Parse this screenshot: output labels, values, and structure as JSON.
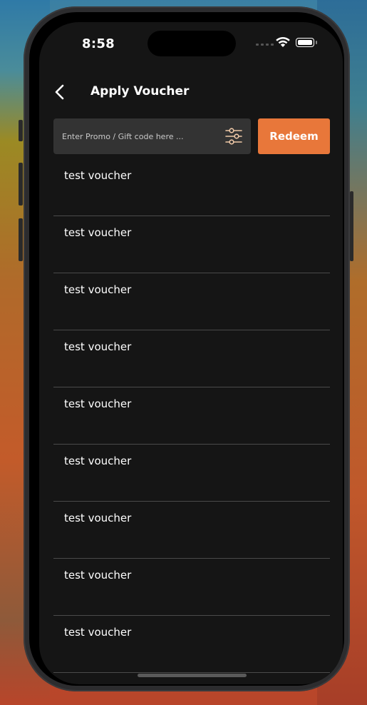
{
  "status_bar": {
    "time": "8:58"
  },
  "header": {
    "title": "Apply Voucher"
  },
  "promo": {
    "placeholder": "Enter Promo / Gift code here ...",
    "value": "",
    "redeem_label": "Redeem"
  },
  "vouchers": [
    {
      "name": "test voucher"
    },
    {
      "name": "test voucher"
    },
    {
      "name": "test voucher"
    },
    {
      "name": "test voucher"
    },
    {
      "name": "test voucher"
    },
    {
      "name": "test voucher"
    },
    {
      "name": "test voucher"
    },
    {
      "name": "test voucher"
    },
    {
      "name": "test voucher"
    }
  ],
  "colors": {
    "accent": "#E8773A",
    "background": "#151515",
    "input_background": "#333333",
    "divider": "#4A4A4A"
  }
}
